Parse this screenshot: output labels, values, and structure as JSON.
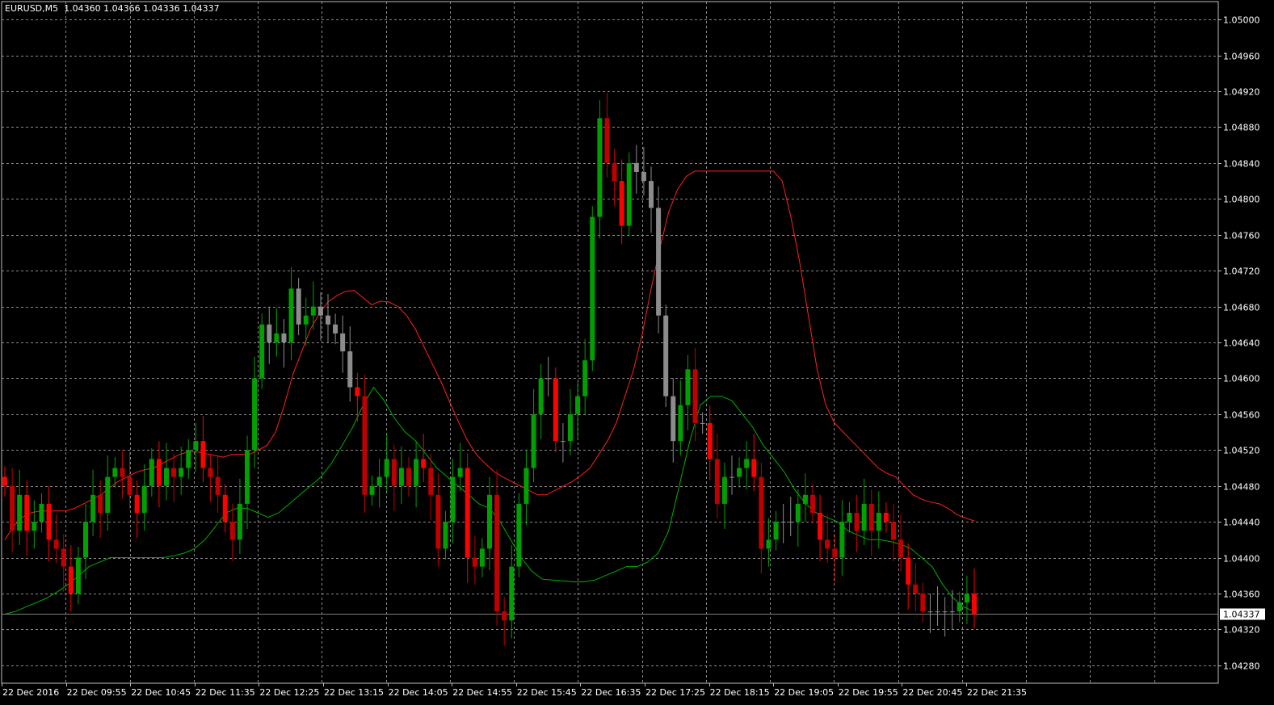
{
  "header": {
    "symbol": "EURUSD,M5",
    "open": "1.04360",
    "high": "1.04366",
    "low": "1.04336",
    "close": "1.04337"
  },
  "colors": {
    "background": "#000000",
    "grid": "#8a8a8a",
    "bull": "#00a000",
    "bear": "#c00000",
    "bear_bright": "#ff0000",
    "neutral": "#8c8c8c",
    "ma_red": "#ff2020",
    "ma_green": "#00b000",
    "price_line": "#808080"
  },
  "chart_data": {
    "type": "candlestick",
    "ylim": [
      1.0426,
      1.0502
    ],
    "y_ticks": [
      "1.05000",
      "1.04960",
      "1.04920",
      "1.04880",
      "1.04840",
      "1.04800",
      "1.04760",
      "1.04720",
      "1.04680",
      "1.04640",
      "1.04600",
      "1.04560",
      "1.04520",
      "1.04480",
      "1.04440",
      "1.04400",
      "1.04360",
      "1.04320",
      "1.04280"
    ],
    "x_ticks": [
      "22 Dec 2016",
      "22 Dec 09:55",
      "22 Dec 10:45",
      "22 Dec 11:35",
      "22 Dec 12:25",
      "22 Dec 13:15",
      "22 Dec 14:05",
      "22 Dec 14:55",
      "22 Dec 15:45",
      "22 Dec 16:35",
      "22 Dec 17:25",
      "22 Dec 18:15",
      "22 Dec 19:05",
      "22 Dec 19:55",
      "22 Dec 20:45",
      "22 Dec 21:35"
    ],
    "current_price": "1.04337",
    "close_series": [
      1.0448,
      1.0443,
      1.0447,
      1.0443,
      1.0444,
      1.0446,
      1.0442,
      1.0441,
      1.0439,
      1.0436,
      1.044,
      1.0444,
      1.0447,
      1.0445,
      1.0449,
      1.045,
      1.0449,
      1.0447,
      1.0445,
      1.0448,
      1.0451,
      1.0448,
      1.045,
      1.0449,
      1.045,
      1.0452,
      1.0453,
      1.045,
      1.0449,
      1.0447,
      1.0444,
      1.0442,
      1.0446,
      1.0452,
      1.046,
      1.0466,
      1.0464,
      1.0465,
      1.0464,
      1.047,
      1.0466,
      1.0467,
      1.0468,
      1.0467,
      1.0466,
      1.0465,
      1.0463,
      1.0459,
      1.0458,
      1.0447,
      1.0448,
      1.0449,
      1.0451,
      1.0448,
      1.045,
      1.0448,
      1.0451,
      1.045,
      1.0447,
      1.0441,
      1.0444,
      1.0449,
      1.045,
      1.044,
      1.0439,
      1.0441,
      1.0447,
      1.0434,
      1.0433,
      1.0439,
      1.0446,
      1.045,
      1.0456,
      1.046,
      1.046,
      1.0453,
      1.0453,
      1.0456,
      1.0458,
      1.0462,
      1.0478,
      1.0489,
      1.0484,
      1.0482,
      1.0477,
      1.0484,
      1.0483,
      1.0482,
      1.0479,
      1.0467,
      1.0458,
      1.0453,
      1.0457,
      1.0461,
      1.0455,
      1.0455,
      1.0451,
      1.0446,
      1.0449,
      1.0449,
      1.045,
      1.0451,
      1.0449,
      1.0441,
      1.0442,
      1.0444,
      1.0444,
      1.0444,
      1.0446,
      1.0447,
      1.0445,
      1.0442,
      1.0441,
      1.044,
      1.0444,
      1.0445,
      1.0443,
      1.0446,
      1.0443,
      1.0445,
      1.0444,
      1.0442,
      1.044,
      1.0437,
      1.0436,
      1.0434,
      1.0434,
      1.0434,
      1.0434,
      1.0434,
      1.0435,
      1.0436,
      1.04337
    ],
    "ma_red": [
      1.0442,
      1.04435,
      1.04445,
      1.0445,
      1.04452,
      1.04452,
      1.04452,
      1.04452,
      1.04455,
      1.0446,
      1.04465,
      1.0447,
      1.04478,
      1.04485,
      1.0449,
      1.04495,
      1.04498,
      1.045,
      1.04505,
      1.0451,
      1.04515,
      1.04518,
      1.04518,
      1.04516,
      1.04514,
      1.04512,
      1.04515,
      1.04515,
      1.04515,
      1.0452,
      1.04525,
      1.0454,
      1.0457,
      1.04605,
      1.0463,
      1.04655,
      1.04672,
      1.04685,
      1.04692,
      1.04697,
      1.04698,
      1.0469,
      1.04682,
      1.04686,
      1.04685,
      1.0468,
      1.0467,
      1.04655,
      1.04635,
      1.04615,
      1.04595,
      1.04572,
      1.0455,
      1.0453,
      1.04515,
      1.04505,
      1.04496,
      1.0449,
      1.04485,
      1.0448,
      1.04475,
      1.0447,
      1.0447,
      1.04475,
      1.0448,
      1.04485,
      1.04492,
      1.045,
      1.04515,
      1.0453,
      1.0455,
      1.0458,
      1.0461,
      1.0465,
      1.047,
      1.04745,
      1.04785,
      1.0481,
      1.04825,
      1.04831,
      1.04831,
      1.04831,
      1.04831,
      1.04831,
      1.04831,
      1.04831,
      1.04831,
      1.04831,
      1.04831,
      1.0482,
      1.0478,
      1.0473,
      1.0467,
      1.0461,
      1.0457,
      1.0455,
      1.0454,
      1.0453,
      1.0452,
      1.0451,
      1.045,
      1.04494,
      1.0449,
      1.0448,
      1.0447,
      1.04465,
      1.04462,
      1.0446,
      1.04455,
      1.04448,
      1.04444,
      1.04441
    ],
    "ma_green": [
      1.04337,
      1.0434,
      1.04345,
      1.0435,
      1.04355,
      1.04362,
      1.0437,
      1.0438,
      1.0439,
      1.04395,
      1.044,
      1.044,
      1.044,
      1.044,
      1.044,
      1.044,
      1.04402,
      1.04405,
      1.0441,
      1.0442,
      1.04435,
      1.0445,
      1.04455,
      1.04455,
      1.0445,
      1.04445,
      1.0445,
      1.0446,
      1.0447,
      1.0448,
      1.0449,
      1.04505,
      1.04525,
      1.04545,
      1.0457,
      1.0459,
      1.04575,
      1.04555,
      1.0454,
      1.0453,
      1.04515,
      1.045,
      1.0449,
      1.0448,
      1.0447,
      1.0446,
      1.04455,
      1.0444,
      1.0442,
      1.044,
      1.04385,
      1.04376,
      1.04375,
      1.04374,
      1.04373,
      1.04373,
      1.04375,
      1.0438,
      1.04385,
      1.0439,
      1.0439,
      1.04395,
      1.04405,
      1.0443,
      1.0448,
      1.0453,
      1.0457,
      1.0458,
      1.0458,
      1.04575,
      1.0456,
      1.04545,
      1.04525,
      1.0451,
      1.04495,
      1.04475,
      1.0446,
      1.0445,
      1.04445,
      1.0444,
      1.0443,
      1.04425,
      1.0442,
      1.0442,
      1.04418,
      1.04415,
      1.0441,
      1.044,
      1.0439,
      1.0437,
      1.04355,
      1.04345,
      1.0434
    ]
  }
}
